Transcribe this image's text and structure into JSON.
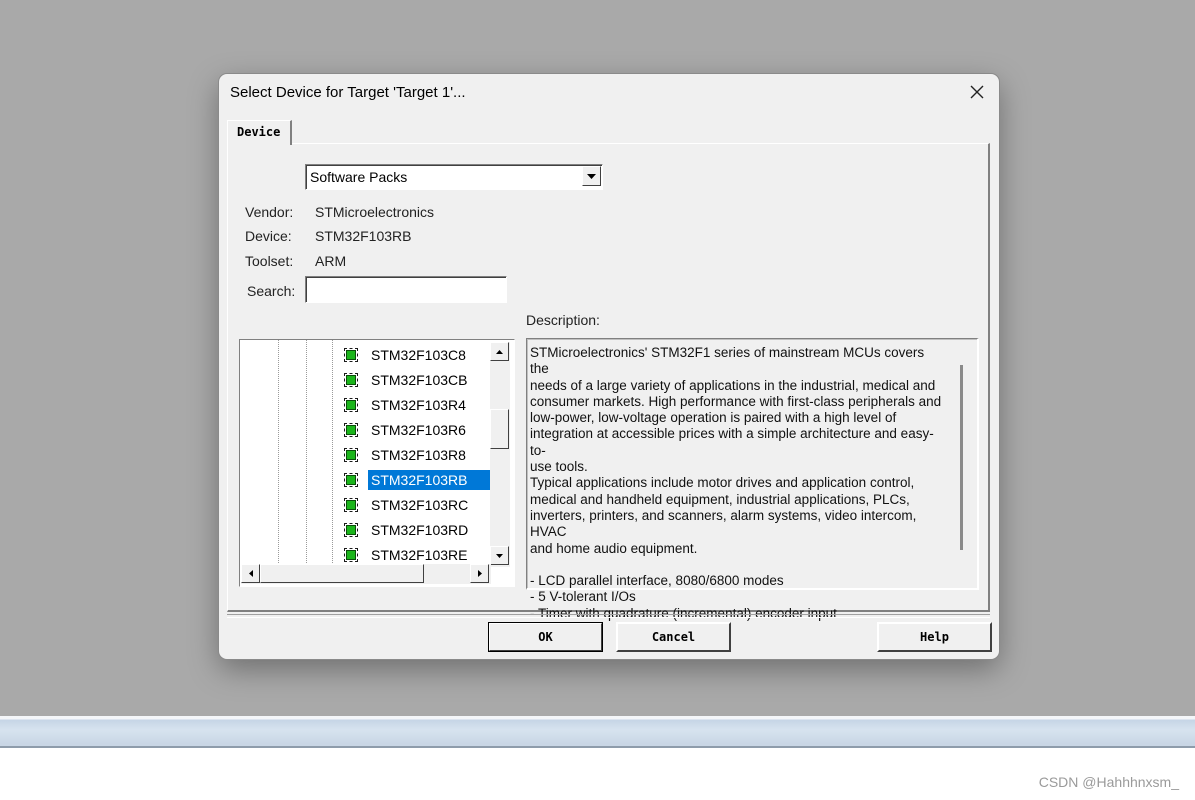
{
  "dialog": {
    "title": "Select Device for Target 'Target 1'...",
    "tab_label": "Device"
  },
  "source_select": {
    "value": "Software Packs"
  },
  "fields": {
    "vendor_label": "Vendor:",
    "vendor_value": "STMicroelectronics",
    "device_label": "Device:",
    "device_value": "STM32F103RB",
    "toolset_label": "Toolset:",
    "toolset_value": "ARM",
    "search_label": "Search:",
    "search_value": ""
  },
  "device_tree": {
    "items": [
      {
        "label": "STM32F103C8",
        "selected": false
      },
      {
        "label": "STM32F103CB",
        "selected": false
      },
      {
        "label": "STM32F103R4",
        "selected": false
      },
      {
        "label": "STM32F103R6",
        "selected": false
      },
      {
        "label": "STM32F103R8",
        "selected": false
      },
      {
        "label": "STM32F103RB",
        "selected": true
      },
      {
        "label": "STM32F103RC",
        "selected": false
      },
      {
        "label": "STM32F103RD",
        "selected": false
      },
      {
        "label": "STM32F103RE",
        "selected": false
      }
    ],
    "selection_color": "#0078d7",
    "chip_icon_color": "#1bb51b"
  },
  "description": {
    "label": "Description:",
    "text": "STMicroelectronics' STM32F1 series of mainstream MCUs covers the\nneeds of a large variety of applications in the industrial, medical and\nconsumer markets. High performance with first-class peripherals and\nlow-power, low-voltage operation is paired with a high level of\nintegration at accessible prices with a simple architecture and easy-to-\nuse tools.\nTypical applications include motor drives and application control,\nmedical and handheld equipment, industrial applications, PLCs,\ninverters, printers, and scanners, alarm systems, video intercom, HVAC\nand home audio equipment.\n\n - LCD parallel interface, 8080/6800 modes\n - 5 V-tolerant I/Os\n - Timer with quadrature (incremental) encoder input"
  },
  "buttons": {
    "ok": "OK",
    "cancel": "Cancel",
    "help": "Help"
  },
  "watermark": "CSDN @Hahhhnxsm_"
}
